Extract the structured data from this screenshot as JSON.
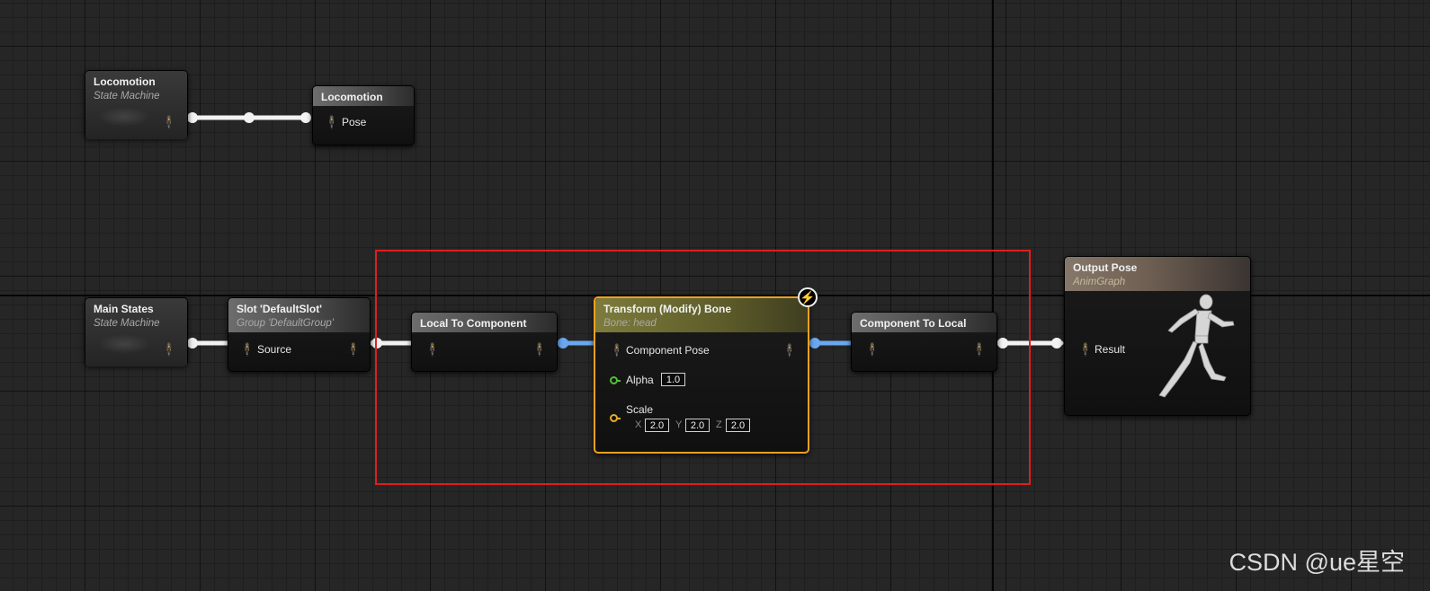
{
  "nodes": {
    "locomotion_sm": {
      "title": "Locomotion",
      "subtitle": "State Machine"
    },
    "locomotion_pose": {
      "title": "Locomotion",
      "pin": "Pose"
    },
    "main_states": {
      "title": "Main States",
      "subtitle": "State Machine"
    },
    "slot": {
      "title": "Slot 'DefaultSlot'",
      "subtitle": "Group 'DefaultGroup'",
      "pin": "Source"
    },
    "local_to_component": {
      "title": "Local To Component"
    },
    "transform_bone": {
      "title": "Transform (Modify) Bone",
      "subtitle": "Bone: head",
      "pin_pose": "Component Pose",
      "alpha_label": "Alpha",
      "alpha_value": "1.0",
      "scale_label": "Scale",
      "x_label": "X",
      "x_value": "2.0",
      "y_label": "Y",
      "y_value": "2.0",
      "z_label": "Z",
      "z_value": "2.0"
    },
    "component_to_local": {
      "title": "Component To Local"
    },
    "output_pose": {
      "title": "Output Pose",
      "subtitle": "AnimGraph",
      "pin": "Result"
    }
  },
  "icons": {
    "pose_pin": "person-icon",
    "fast_path": "lightning-icon",
    "mannequin": "running-mannequin-icon"
  },
  "colors": {
    "exec_pose_wire": "#f2f2f2",
    "component_space_wire": "#6aa8f0",
    "selection_box": "#e01e1e",
    "selected_node_outline": "#f0a020",
    "float_pin": "#4ec23a",
    "vector_pin": "#e8ad2c"
  },
  "watermark": "CSDN @ue星空"
}
